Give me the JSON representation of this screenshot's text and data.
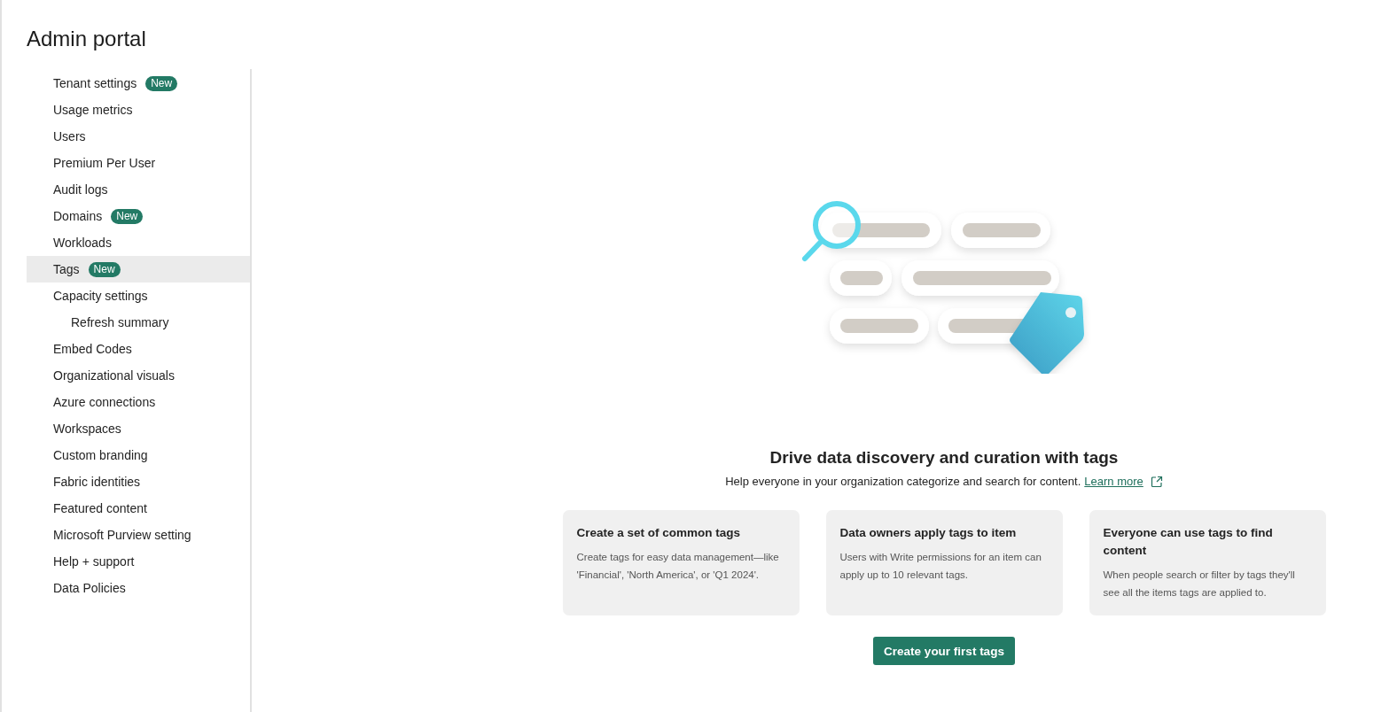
{
  "page": {
    "title": "Admin portal"
  },
  "sidebar": {
    "items": [
      {
        "label": "Tenant settings",
        "badge": "New",
        "selected": false
      },
      {
        "label": "Usage metrics",
        "selected": false
      },
      {
        "label": "Users",
        "selected": false
      },
      {
        "label": "Premium Per User",
        "selected": false
      },
      {
        "label": "Audit logs",
        "selected": false
      },
      {
        "label": "Domains",
        "badge": "New",
        "selected": false
      },
      {
        "label": "Workloads",
        "selected": false
      },
      {
        "label": "Tags",
        "badge": "New",
        "selected": true
      },
      {
        "label": "Capacity settings",
        "selected": false,
        "children": [
          {
            "label": "Refresh summary",
            "selected": false
          }
        ]
      },
      {
        "label": "Embed Codes",
        "selected": false
      },
      {
        "label": "Organizational visuals",
        "selected": false
      },
      {
        "label": "Azure connections",
        "selected": false
      },
      {
        "label": "Workspaces",
        "selected": false
      },
      {
        "label": "Custom branding",
        "selected": false
      },
      {
        "label": "Fabric identities",
        "selected": false
      },
      {
        "label": "Featured content",
        "selected": false
      },
      {
        "label": "Microsoft Purview setting",
        "selected": false
      },
      {
        "label": "Help + support",
        "selected": false
      },
      {
        "label": "Data Policies",
        "selected": false
      }
    ]
  },
  "main": {
    "heading": "Drive data discovery and curation with tags",
    "description": "Help everyone in your organization categorize and search for content.",
    "link": "Learn more",
    "cards": [
      {
        "title": "Create a set of common tags",
        "text": "Create tags for easy data management—like 'Financial', 'North America', or 'Q1 2024'."
      },
      {
        "title": "Data owners apply tags to item",
        "text": "Users with Write permissions for an item can apply up to 10 relevant tags."
      },
      {
        "title": "Everyone can use tags to find content",
        "text": "When people search or filter by tags they'll see all the items tags are applied to."
      }
    ],
    "button": "Create your first tags"
  }
}
